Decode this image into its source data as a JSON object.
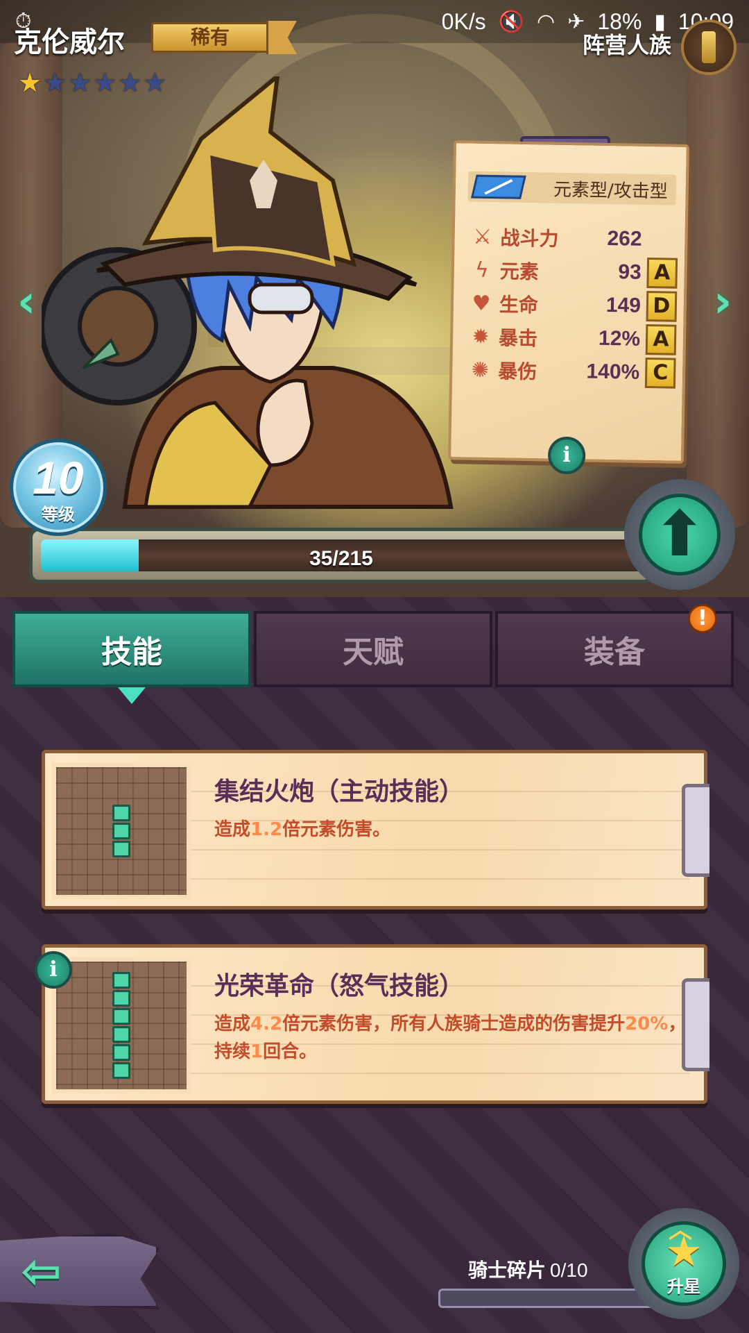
{
  "status_bar": {
    "network_speed": "0K/s",
    "battery": "18%",
    "time": "10:09"
  },
  "hero": {
    "name": "克伦威尔",
    "rarity": "稀有",
    "stars_filled": 1,
    "stars_total": 6,
    "faction": "阵营人族",
    "type": "元素型/攻击型",
    "level": "10",
    "level_label": "等级",
    "exp_current": 35,
    "exp_max": 215,
    "exp_text": "35/215"
  },
  "stats": [
    {
      "icon": "power-icon",
      "label": "战斗力",
      "value": "262",
      "grade": ""
    },
    {
      "icon": "lightning-icon",
      "label": "元素",
      "value": "93",
      "grade": "A"
    },
    {
      "icon": "heart-icon",
      "label": "生命",
      "value": "149",
      "grade": "D"
    },
    {
      "icon": "crit-icon",
      "label": "暴击",
      "value": "12%",
      "grade": "A"
    },
    {
      "icon": "crit-damage-icon",
      "label": "暴伤",
      "value": "140%",
      "grade": "C"
    }
  ],
  "tabs": [
    {
      "label": "技能",
      "active": true
    },
    {
      "label": "天赋",
      "active": false
    },
    {
      "label": "装备",
      "active": false,
      "alert": "!"
    }
  ],
  "skills": [
    {
      "title": "集结火炮（主动技能）",
      "description": "造成1.2倍元素伤害。",
      "blocks": 3
    },
    {
      "title": "光荣革命（怒气技能）",
      "description": "造成4.2倍元素伤害，所有人族骑士造成的伤害提升20%，持续1回合。",
      "blocks": 6
    }
  ],
  "shards": {
    "label": "骑士碎片",
    "count": "0/10",
    "current": 0,
    "max": 10
  },
  "star_up": {
    "label": "升星"
  },
  "colors": {
    "accent_teal": "#3fae96",
    "rarity_gold": "#f3cd6a",
    "stat_label": "#b84a2f",
    "skill_title": "#5a2e57"
  }
}
